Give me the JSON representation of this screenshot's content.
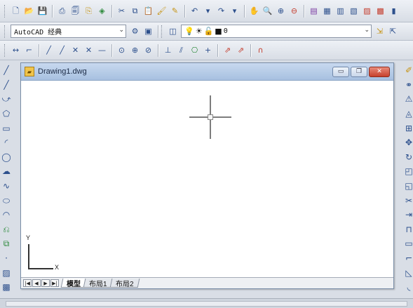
{
  "toolbar_standard": {
    "icons": [
      {
        "name": "new-icon",
        "glyph": "🗋",
        "tone": ""
      },
      {
        "name": "open-icon",
        "glyph": "📂",
        "tone": "gold"
      },
      {
        "name": "save-icon",
        "glyph": "💾",
        "tone": ""
      },
      {
        "sep": true
      },
      {
        "name": "print-icon",
        "glyph": "⎙",
        "tone": ""
      },
      {
        "name": "print-preview-icon",
        "glyph": "🗐",
        "tone": ""
      },
      {
        "name": "publish-icon",
        "glyph": "⎘",
        "tone": "gold"
      },
      {
        "name": "3d-dwf-icon",
        "glyph": "◈",
        "tone": "green"
      },
      {
        "sep": true
      },
      {
        "name": "cut-icon",
        "glyph": "✂",
        "tone": ""
      },
      {
        "name": "copy-icon",
        "glyph": "⧉",
        "tone": ""
      },
      {
        "name": "paste-icon",
        "glyph": "📋",
        "tone": "gold"
      },
      {
        "name": "match-properties-icon",
        "glyph": "🖌",
        "tone": "gold"
      },
      {
        "name": "block-editor-icon",
        "glyph": "✎",
        "tone": "gold"
      },
      {
        "sep": true
      },
      {
        "name": "undo-icon",
        "glyph": "↶",
        "tone": ""
      },
      {
        "name": "undo-dropdown-icon",
        "glyph": "▾",
        "tone": ""
      },
      {
        "name": "redo-icon",
        "glyph": "↷",
        "tone": ""
      },
      {
        "name": "redo-dropdown-icon",
        "glyph": "▾",
        "tone": ""
      },
      {
        "sep": true
      },
      {
        "name": "pan-icon",
        "glyph": "✋",
        "tone": "red"
      },
      {
        "name": "zoom-realtime-icon",
        "glyph": "🔍",
        "tone": ""
      },
      {
        "name": "zoom-window-icon",
        "glyph": "⊕",
        "tone": ""
      },
      {
        "name": "zoom-previous-icon",
        "glyph": "⊖",
        "tone": "red"
      },
      {
        "sep": true
      },
      {
        "name": "properties-icon",
        "glyph": "▤",
        "tone": "purple"
      },
      {
        "name": "design-center-icon",
        "glyph": "▦",
        "tone": ""
      },
      {
        "name": "tool-palettes-icon",
        "glyph": "▥",
        "tone": ""
      },
      {
        "name": "sheet-set-icon",
        "glyph": "▧",
        "tone": ""
      },
      {
        "name": "markup-icon",
        "glyph": "▨",
        "tone": "red"
      },
      {
        "name": "quickcalc-icon",
        "glyph": "▩",
        "tone": "red"
      },
      {
        "name": "help-icon",
        "glyph": "▮",
        "tone": ""
      }
    ]
  },
  "toolbar_workspace": {
    "workspace_value": "AutoCAD 经典",
    "layer_value": "0",
    "layer_state_icons": [
      "💡",
      "☀",
      "🔓",
      "■"
    ],
    "left_icons": [
      {
        "name": "workspace-settings-icon",
        "glyph": "⚙",
        "tone": ""
      },
      {
        "name": "save-workspace-icon",
        "glyph": "▣",
        "tone": ""
      }
    ],
    "layer_manager_icon": {
      "name": "layer-manager-icon",
      "glyph": "◫",
      "tone": ""
    },
    "right_icons": [
      {
        "name": "make-current-layer-icon",
        "glyph": "⇲",
        "tone": "gold"
      },
      {
        "name": "layer-previous-icon",
        "glyph": "⇱",
        "tone": ""
      }
    ]
  },
  "toolbar_dimension": {
    "icons": [
      {
        "name": "linear-dimension-icon",
        "glyph": "↔",
        "tone": ""
      },
      {
        "name": "aligned-dimension-icon",
        "glyph": "⌐",
        "tone": ""
      },
      {
        "sep": true
      },
      {
        "name": "arc-length-icon",
        "glyph": "╱",
        "tone": ""
      },
      {
        "name": "ordinate-icon",
        "glyph": "╱",
        "tone": ""
      },
      {
        "name": "radius-icon",
        "glyph": "✕",
        "tone": ""
      },
      {
        "name": "jogged-icon",
        "glyph": "✕",
        "tone": ""
      },
      {
        "name": "diameter-icon",
        "glyph": "—",
        "tone": ""
      },
      {
        "sep": true
      },
      {
        "name": "angular-icon",
        "glyph": "⊙",
        "tone": ""
      },
      {
        "name": "quick-dimension-icon",
        "glyph": "⊕",
        "tone": ""
      },
      {
        "name": "baseline-icon",
        "glyph": "⊘",
        "tone": ""
      },
      {
        "sep": true
      },
      {
        "name": "continue-icon",
        "glyph": "⊥",
        "tone": ""
      },
      {
        "name": "dimension-space-icon",
        "glyph": "⫽",
        "tone": ""
      },
      {
        "name": "tolerance-icon",
        "glyph": "⎔",
        "tone": "green"
      },
      {
        "name": "center-mark-icon",
        "glyph": "+",
        "tone": ""
      },
      {
        "sep": true
      },
      {
        "name": "dimension-edit-icon",
        "glyph": "⇗",
        "tone": "red"
      },
      {
        "name": "dimension-text-edit-icon",
        "glyph": "⇗",
        "tone": "red"
      },
      {
        "sep": true
      },
      {
        "name": "dimension-update-icon",
        "glyph": "∩",
        "tone": "red"
      }
    ]
  },
  "draw_toolbar": [
    {
      "name": "line-icon",
      "glyph": "╱",
      "tone": ""
    },
    {
      "name": "construction-line-icon",
      "glyph": "╱",
      "tone": ""
    },
    {
      "name": "polyline-icon",
      "glyph": "⤻",
      "tone": ""
    },
    {
      "name": "polygon-icon",
      "glyph": "⬠",
      "tone": ""
    },
    {
      "name": "rectangle-icon",
      "glyph": "▭",
      "tone": ""
    },
    {
      "name": "arc-icon",
      "glyph": "◜",
      "tone": ""
    },
    {
      "name": "circle-icon",
      "glyph": "◯",
      "tone": ""
    },
    {
      "name": "revision-cloud-icon",
      "glyph": "☁",
      "tone": ""
    },
    {
      "name": "spline-icon",
      "glyph": "∿",
      "tone": ""
    },
    {
      "name": "ellipse-icon",
      "glyph": "⬭",
      "tone": ""
    },
    {
      "name": "ellipse-arc-icon",
      "glyph": "◠",
      "tone": ""
    },
    {
      "name": "insert-block-icon",
      "glyph": "⎌",
      "tone": "green"
    },
    {
      "name": "make-block-icon",
      "glyph": "⧉",
      "tone": "green"
    },
    {
      "name": "point-icon",
      "glyph": "·",
      "tone": ""
    },
    {
      "name": "hatch-icon",
      "glyph": "▨",
      "tone": ""
    },
    {
      "name": "gradient-icon",
      "glyph": "▩",
      "tone": ""
    }
  ],
  "modify_toolbar": [
    {
      "name": "erase-icon",
      "glyph": "✐",
      "tone": "gold"
    },
    {
      "name": "copy-object-icon",
      "glyph": "⚭",
      "tone": ""
    },
    {
      "name": "mirror-icon",
      "glyph": "⚠",
      "tone": ""
    },
    {
      "name": "offset-icon",
      "glyph": "◬",
      "tone": ""
    },
    {
      "name": "array-icon",
      "glyph": "⊞",
      "tone": ""
    },
    {
      "name": "move-icon",
      "glyph": "✥",
      "tone": ""
    },
    {
      "name": "rotate-icon",
      "glyph": "↻",
      "tone": ""
    },
    {
      "name": "scale-icon",
      "glyph": "◰",
      "tone": ""
    },
    {
      "name": "stretch-icon",
      "glyph": "◱",
      "tone": ""
    },
    {
      "name": "trim-icon",
      "glyph": "✂",
      "tone": ""
    },
    {
      "name": "extend-icon",
      "glyph": "⇥",
      "tone": ""
    },
    {
      "name": "break-at-point-icon",
      "glyph": "⊓",
      "tone": ""
    },
    {
      "name": "break-icon",
      "glyph": "▭",
      "tone": ""
    },
    {
      "name": "join-icon",
      "glyph": "⌐",
      "tone": ""
    },
    {
      "name": "chamfer-icon",
      "glyph": "◺",
      "tone": ""
    },
    {
      "name": "fillet-icon",
      "glyph": "◟",
      "tone": ""
    }
  ],
  "drawing_window": {
    "title": "Drawing1.dwg",
    "minimize_glyph": "▭",
    "restore_glyph": "❐",
    "close_glyph": "✕"
  },
  "ucs": {
    "x_label": "X",
    "y_label": "Y"
  },
  "layout_tabs": {
    "nav": [
      "|◀",
      "◀",
      "▶",
      "▶|"
    ],
    "tabs": [
      "模型",
      "布局1",
      "布局2"
    ]
  }
}
